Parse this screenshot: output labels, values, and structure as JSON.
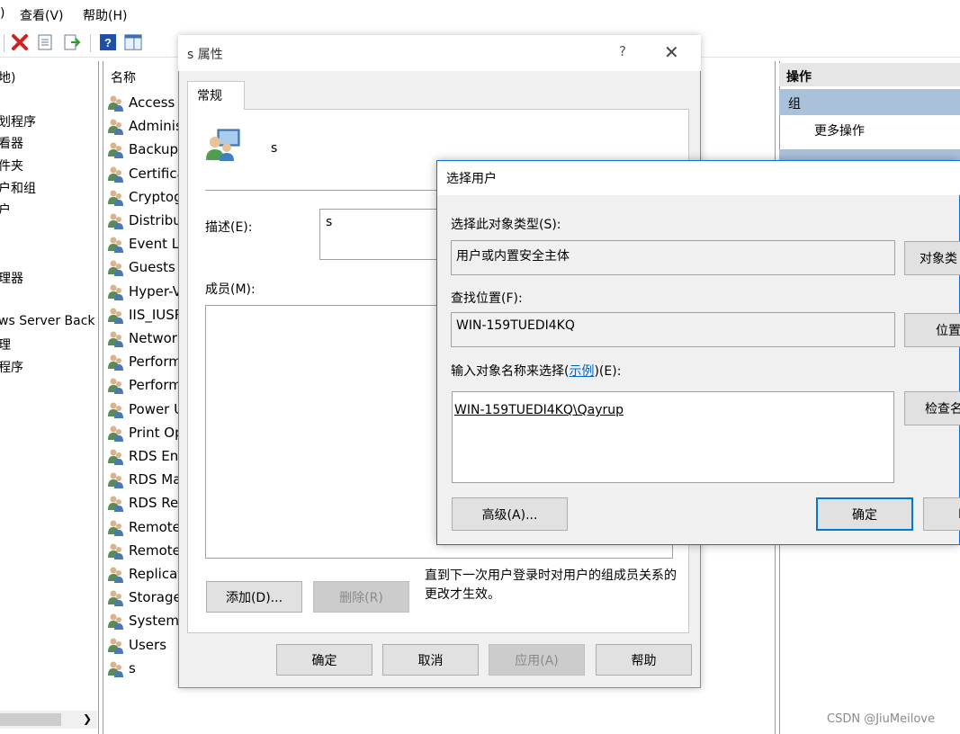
{
  "menubar": {
    "partial": ")",
    "view": "查看(V)",
    "help": "帮助(H)"
  },
  "toolbar": {
    "icons": [
      "delete-icon",
      "properties-icon",
      "export-icon",
      "help-icon",
      "show-pane-icon"
    ]
  },
  "tree": {
    "items": [
      "地)",
      "划程序",
      "看器",
      "件夹",
      "户和组",
      "户",
      "理器",
      "ws Server Back",
      "理",
      "程序"
    ]
  },
  "groups": {
    "header": "名称",
    "items": [
      "Access",
      "Adminis",
      "Backup",
      "Certifica",
      "Cryptog",
      "Distribu",
      "Event Lo",
      "Guests",
      "Hyper-V",
      "IIS_IUSR",
      "Network",
      "Perform",
      "Perform",
      "Power U",
      "Print Op",
      "RDS End",
      "RDS Ma",
      "RDS Re",
      "Remote",
      "Remote",
      "Replicat",
      "Storage",
      "System",
      "Users",
      "s"
    ]
  },
  "actions": {
    "header": "操作",
    "group": "组",
    "more": "更多操作"
  },
  "prop_dialog": {
    "title": "s 属性",
    "help_glyph": "?",
    "close_glyph": "✕",
    "tab": "常规",
    "name": "s",
    "desc_label": "描述(E):",
    "desc_value": "s",
    "members_label": "成员(M):",
    "note": "直到下一次用户登录时对用户的组成员关系的更改才生效。",
    "add_button": "添加(D)...",
    "remove_button": "删除(R)",
    "ok_button": "确定",
    "cancel_button": "取消",
    "apply_button": "应用(A)",
    "help_button": "帮助"
  },
  "select_user": {
    "title": "选择用户",
    "type_label": "选择此对象类型(S):",
    "type_value": "用户或内置安全主体",
    "type_button": "对象类",
    "location_label": "查找位置(F):",
    "location_value": "WIN-159TUEDI4KQ",
    "location_button": "位置",
    "names_label_pre": "输入对象名称来选择(",
    "names_label_link": "示例",
    "names_label_post": ")(E):",
    "names_value": "WIN-159TUEDI4KQ\\Qayrup",
    "check_button": "检查名",
    "advanced_button": "高级(A)...",
    "ok_button": "确定",
    "cancel_button_partial": "I"
  },
  "watermark": "CSDN @JiuMeilove",
  "colors": {
    "accent": "#0078d7",
    "selection": "#a9c2da"
  }
}
